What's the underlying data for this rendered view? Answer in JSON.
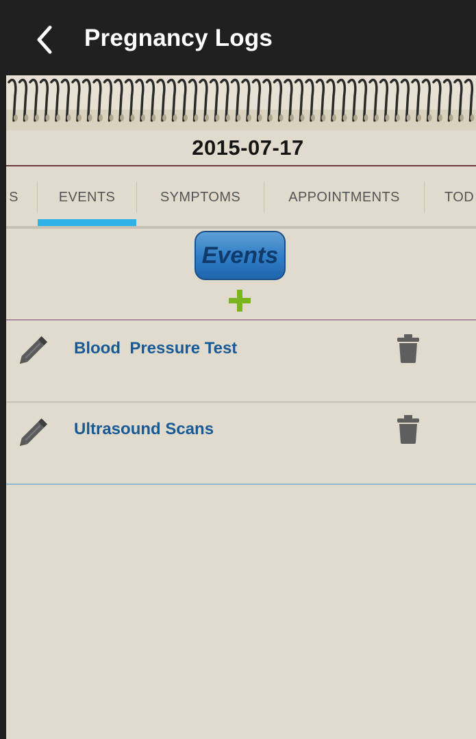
{
  "header": {
    "title": "Pregnancy Logs",
    "back_icon": "chevron-left-icon"
  },
  "date": "2015-07-17",
  "tabs": [
    {
      "label": "S"
    },
    {
      "label": "EVENTS",
      "selected": true
    },
    {
      "label": "SYMPTOMS"
    },
    {
      "label": "APPOINTMENTS"
    },
    {
      "label": "TOD"
    }
  ],
  "section": {
    "title": "Events",
    "add_icon": "plus-icon"
  },
  "events": [
    {
      "title": "Blood  Pressure Test",
      "edit_icon": "pencil-icon",
      "delete_icon": "trash-icon"
    },
    {
      "title": "Ultrasound Scans",
      "edit_icon": "pencil-icon",
      "delete_icon": "trash-icon"
    }
  ],
  "colors": {
    "appbar": "#202020",
    "page": "#e0dbcd",
    "tab_indicator": "#2fb2e8",
    "events_button": "#2f7cc6",
    "event_text": "#185a96",
    "add_icon": "#7ab51d"
  }
}
